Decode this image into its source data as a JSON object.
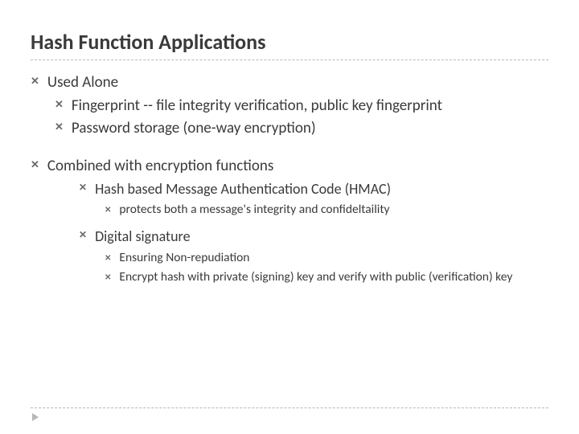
{
  "title": "Hash Function Applications",
  "b1": "Used Alone",
  "b1_1": "Fingerprint -- file integrity verification, public key fingerprint",
  "b1_2": "Password storage (one-way encryption)",
  "b2": "Combined with encryption functions",
  "b2_1": "Hash based Message Authentication Code (HMAC)",
  "b2_1_1": "protects both a message's integrity and confideltaility",
  "b2_2": "Digital signature",
  "b2_2_1": "Ensuring Non-repudiation",
  "b2_2_2": "Encrypt hash with private (signing) key and verify with public (verification) key"
}
